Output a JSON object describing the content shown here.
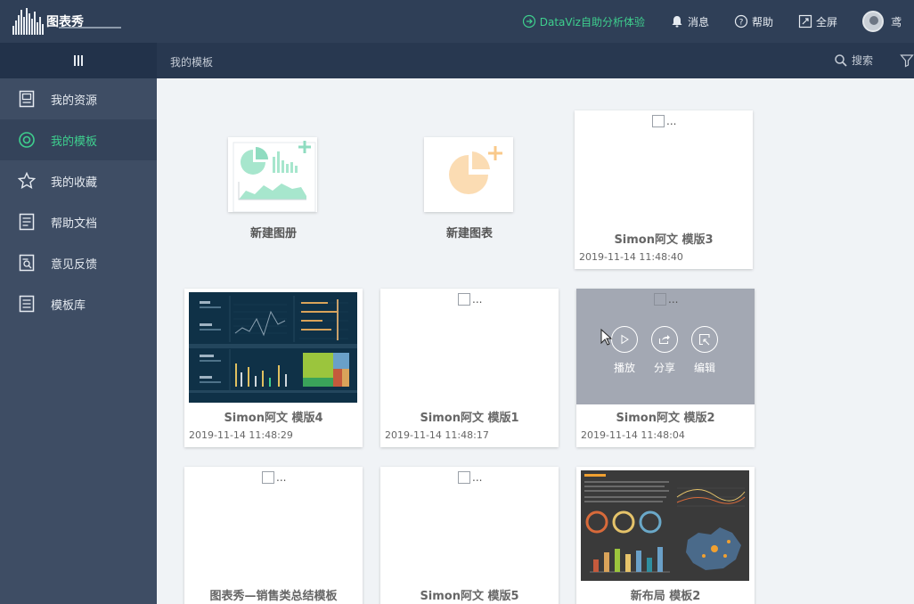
{
  "header": {
    "logo_text": "图表秀",
    "dataviz_link": "DataViz自助分析体验",
    "messages": "消息",
    "help": "帮助",
    "fullscreen": "全屏",
    "user_name": "鸢"
  },
  "subheader": {
    "breadcrumb": "我的模板",
    "search": "搜索"
  },
  "sidebar": {
    "items": [
      {
        "label": "我的资源",
        "icon": "resource-icon"
      },
      {
        "label": "我的模板",
        "icon": "template-icon",
        "active": true
      },
      {
        "label": "我的收藏",
        "icon": "star-icon"
      },
      {
        "label": "帮助文档",
        "icon": "doc-icon"
      },
      {
        "label": "意见反馈",
        "icon": "feedback-icon"
      },
      {
        "label": "模板库",
        "icon": "library-icon"
      }
    ]
  },
  "create": {
    "new_album": "新建图册",
    "new_chart": "新建图表"
  },
  "cards": [
    {
      "title": "Simon阿文 模版3",
      "date": "2019-11-14 11:48:40",
      "check": "..."
    },
    {
      "title": "Simon阿文 模版4",
      "date": "2019-11-14 11:48:29"
    },
    {
      "title": "Simon阿文 模版1",
      "date": "2019-11-14 11:48:17",
      "check": "..."
    },
    {
      "title": "Simon阿文 模版2",
      "date": "2019-11-14 11:48:04",
      "check": "..."
    },
    {
      "title": "图表秀—销售类总结模板",
      "check": "..."
    },
    {
      "title": "Simon阿文 模版5",
      "check": "..."
    },
    {
      "title": "新布局 模板2"
    }
  ],
  "hover_actions": {
    "play": "播放",
    "share": "分享",
    "edit": "编辑"
  },
  "colors": {
    "header_bg": "#2f3f57",
    "sidebar_bg": "#3e4d64",
    "accent_green": "#3ecf8e",
    "overlay": "#a3a8b3"
  }
}
